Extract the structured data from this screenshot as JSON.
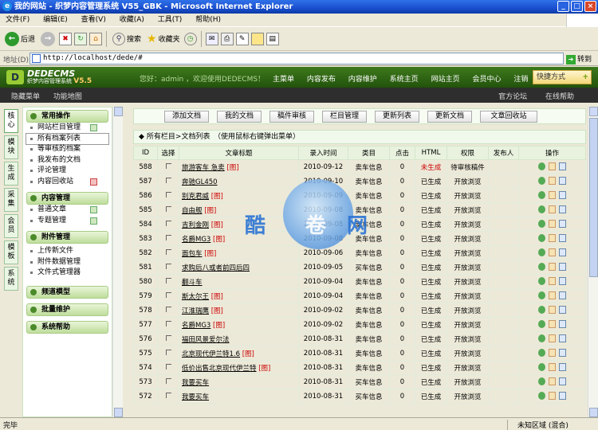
{
  "window": {
    "title": "我的网站 - 织梦内容管理系统 V55_GBK - Microsoft Internet Explorer",
    "controls": [
      "_",
      "□",
      "×"
    ]
  },
  "ie_menu": [
    "文件(F)",
    "编辑(E)",
    "查看(V)",
    "收藏(A)",
    "工具(T)",
    "帮助(H)"
  ],
  "ie_toolbar": {
    "back": "后退",
    "search": "搜索",
    "favorites": "收藏夹"
  },
  "address": {
    "label": "地址(D)",
    "url": "http://localhost/dede/#",
    "go": "转到"
  },
  "cms_header": {
    "logo_main": "DEDECMS",
    "logo_sub": "织梦内容管理系统",
    "version": "V5.5",
    "welcome": "您好：admin ，欢迎使用DEDECMS！",
    "nav": [
      "主菜单",
      "内容发布",
      "内容维护",
      "系统主页",
      "网站主页",
      "会员中心",
      "注销"
    ],
    "shortcut": "快捷方式"
  },
  "sub_bar": {
    "left": [
      "隐藏菜单",
      "功能地图"
    ],
    "right": [
      "官方论坛",
      "在线帮助"
    ]
  },
  "vertical_tabs": [
    "核心",
    "模块",
    "生成",
    "采集",
    "会员",
    "模板",
    "系统"
  ],
  "sidebar": {
    "groups": [
      {
        "title": "常用操作",
        "items": [
          "网站栏目管理",
          "所有档案列表",
          "等审核的档案",
          "我发布的文档",
          "评论管理",
          "内容回收站"
        ]
      },
      {
        "title": "内容管理",
        "items": [
          "普通文章",
          "专题管理"
        ]
      },
      {
        "title": "附件管理",
        "items": [
          "上传新文件",
          "附件数据管理",
          "文件式管理器"
        ]
      },
      {
        "title": "频道模型",
        "items": []
      },
      {
        "title": "批量维护",
        "items": []
      },
      {
        "title": "系统帮助",
        "items": []
      }
    ]
  },
  "action_buttons": [
    "添加文档",
    "我的文档",
    "稿件审核",
    "栏目管理",
    "更新列表",
    "更新文档",
    "文章回收站"
  ],
  "breadcrumb": "所有栏目>文档列表　（使用鼠标右键弹出菜单）",
  "table": {
    "headers": [
      "ID",
      "选择",
      "文章标题",
      "录入时间",
      "类目",
      "点击",
      "HTML",
      "权限",
      "发布人",
      "操作"
    ],
    "rows": [
      {
        "id": "588",
        "title": "旅游客车 急卖",
        "tag": "[图]",
        "date": "2010-09-12",
        "cat": "卖车信息",
        "clicks": "0",
        "html": "未生成",
        "perm": "待审核稿件"
      },
      {
        "id": "587",
        "title": "奔驰GL450",
        "tag": "",
        "date": "2010-09-10",
        "cat": "卖车信息",
        "clicks": "0",
        "html": "已生成",
        "perm": "开放浏览"
      },
      {
        "id": "586",
        "title": "别克君威",
        "tag": "[图]",
        "date": "2010-09-09",
        "cat": "卖车信息",
        "clicks": "0",
        "html": "已生成",
        "perm": "开放浏览"
      },
      {
        "id": "585",
        "title": "自由舰",
        "tag": "[图]",
        "date": "2010-09-08",
        "cat": "卖车信息",
        "clicks": "0",
        "html": "已生成",
        "perm": "开放浏览"
      },
      {
        "id": "584",
        "title": "吉利金刚",
        "tag": "[图]",
        "date": "2010-09-08",
        "cat": "卖车信息",
        "clicks": "0",
        "html": "已生成",
        "perm": "开放浏览"
      },
      {
        "id": "583",
        "title": "名爵MG3",
        "tag": "[图]",
        "date": "2010-09-08",
        "cat": "卖车信息",
        "clicks": "0",
        "html": "已生成",
        "perm": "开放浏览"
      },
      {
        "id": "582",
        "title": "面包车",
        "tag": "[图]",
        "date": "2010-09-06",
        "cat": "卖车信息",
        "clicks": "0",
        "html": "已生成",
        "perm": "开放浏览"
      },
      {
        "id": "581",
        "title": "求购后八或者前四后四",
        "tag": "",
        "date": "2010-09-05",
        "cat": "买车信息",
        "clicks": "0",
        "html": "已生成",
        "perm": "开放浏览"
      },
      {
        "id": "580",
        "title": "翻斗车",
        "tag": "",
        "date": "2010-09-04",
        "cat": "卖车信息",
        "clicks": "0",
        "html": "已生成",
        "perm": "开放浏览"
      },
      {
        "id": "579",
        "title": "斯太尔王",
        "tag": "[图]",
        "date": "2010-09-04",
        "cat": "卖车信息",
        "clicks": "0",
        "html": "已生成",
        "perm": "开放浏览"
      },
      {
        "id": "578",
        "title": "江淮瑞鹰",
        "tag": "[图]",
        "date": "2010-09-02",
        "cat": "卖车信息",
        "clicks": "0",
        "html": "已生成",
        "perm": "开放浏览"
      },
      {
        "id": "577",
        "title": "名爵MG3",
        "tag": "[图]",
        "date": "2010-09-02",
        "cat": "卖车信息",
        "clicks": "0",
        "html": "已生成",
        "perm": "开放浏览"
      },
      {
        "id": "576",
        "title": "福田风景爱尔法",
        "tag": "",
        "date": "2010-08-31",
        "cat": "卖车信息",
        "clicks": "0",
        "html": "已生成",
        "perm": "开放浏览"
      },
      {
        "id": "575",
        "title": "北京现代伊兰特1.6",
        "tag": "[图]",
        "date": "2010-08-31",
        "cat": "卖车信息",
        "clicks": "0",
        "html": "已生成",
        "perm": "开放浏览"
      },
      {
        "id": "574",
        "title": "低价出售北京现代伊兰特",
        "tag": "[图]",
        "date": "2010-08-31",
        "cat": "卖车信息",
        "clicks": "0",
        "html": "已生成",
        "perm": "开放浏览"
      },
      {
        "id": "573",
        "title": "我要买车",
        "tag": "",
        "date": "2010-08-31",
        "cat": "买车信息",
        "clicks": "0",
        "html": "已生成",
        "perm": "开放浏览"
      },
      {
        "id": "572",
        "title": "我要买车",
        "tag": "",
        "date": "2010-08-31",
        "cat": "买车信息",
        "clicks": "0",
        "html": "已生成",
        "perm": "开放浏览"
      }
    ]
  },
  "watermark": [
    "酷",
    "卷",
    "网"
  ],
  "statusbar": {
    "left": "完毕",
    "zone": "未知区域 (混合)"
  },
  "colors": {
    "header_green": "#2d6614",
    "status_red": "#cc0000",
    "title_blue": "#0c3aa8"
  }
}
